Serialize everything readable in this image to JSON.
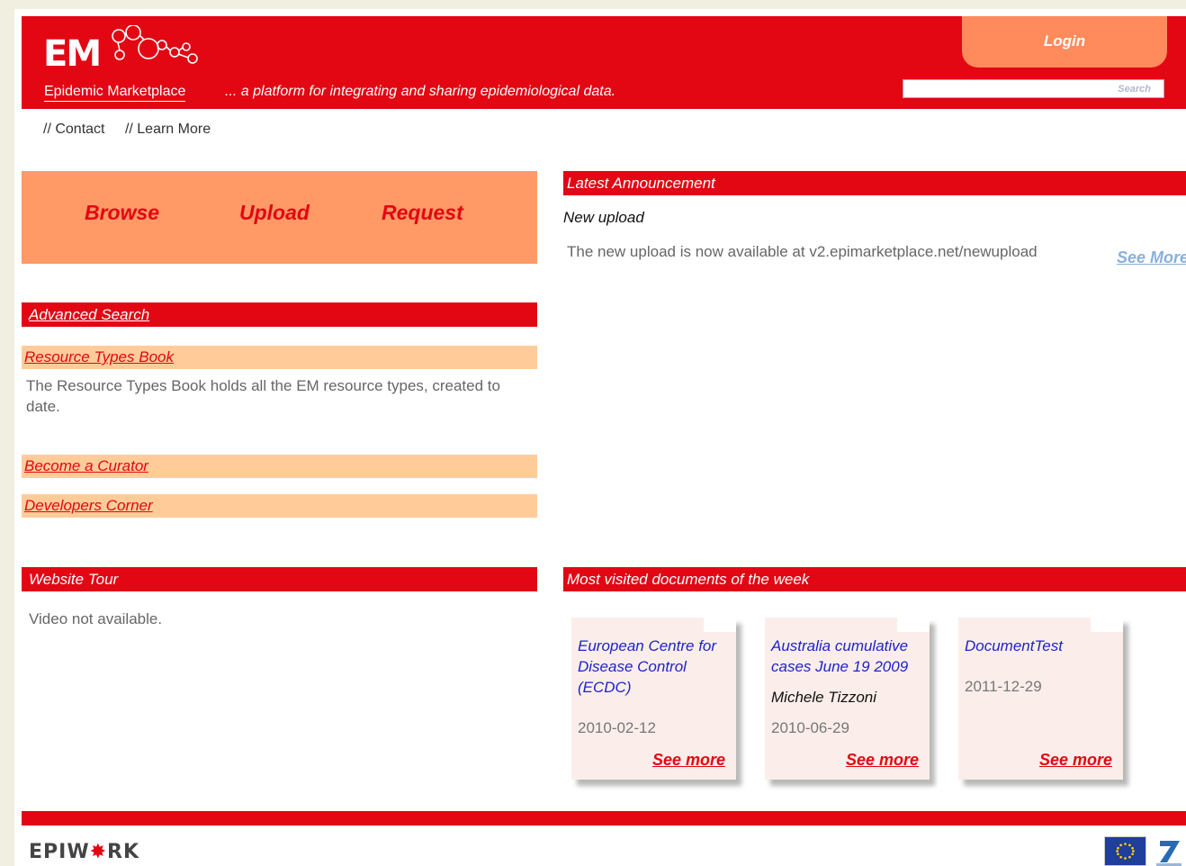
{
  "header": {
    "logo_em": "EM",
    "logo_subtitle": "Epidemic Marketplace",
    "tagline": "... a platform for integrating and sharing epidemiological data.",
    "login_label": "Login",
    "search_placeholder": "Search"
  },
  "topnav": [
    "// Contact",
    "// Learn More"
  ],
  "actions": {
    "browse": "Browse",
    "upload": "Upload",
    "request": "Request"
  },
  "left": {
    "advanced_search": "Advanced Search",
    "resource_types": {
      "title": "Resource Types Book",
      "description": "The Resource Types Book holds all the EM resource types, created to date."
    },
    "become_curator": "Become a Curator",
    "developers_corner": "Developers Corner",
    "website_tour": {
      "title": "Website Tour",
      "text": "Video not available."
    }
  },
  "announcement": {
    "header": "Latest Announcement",
    "title": "New upload",
    "text": "The new upload is now available at v2.epimarketplace.net/newupload",
    "see_more": "See More"
  },
  "most_visited": {
    "header": "Most visited documents of the week",
    "cards": [
      {
        "title": "European Centre for Disease Control (ECDC)",
        "author": "",
        "date": "2010-02-12",
        "see_more": "See more"
      },
      {
        "title": "Australia cumulative cases June 19 2009",
        "author": "Michele Tizzoni",
        "date": "2010-06-29",
        "see_more": "See more"
      },
      {
        "title": "DocumentTest",
        "author": "",
        "date": "2011-12-29",
        "see_more": "See more"
      }
    ]
  },
  "footer": {
    "epiwork_pre": "EPIW",
    "epiwork_star": "✸",
    "epiwork_post": "RK"
  },
  "colors": {
    "brand_red": "#e30613",
    "orange": "#ff9966",
    "peach": "#ffcc99",
    "link_blue": "#1e22cc"
  }
}
